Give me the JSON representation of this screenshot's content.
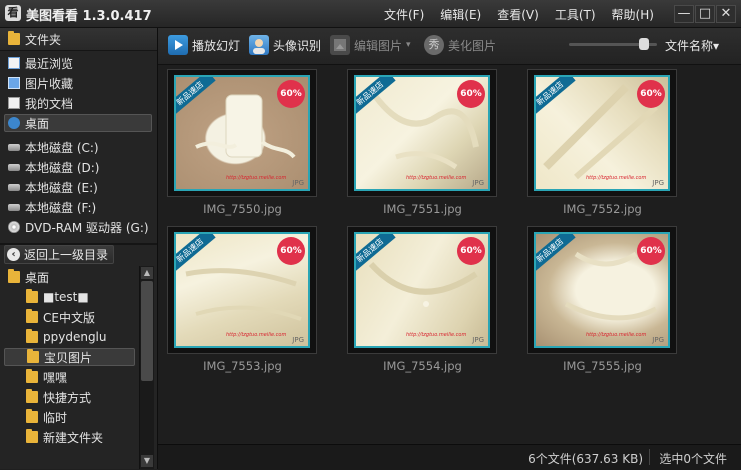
{
  "app": {
    "title": "美图看看 1.3.0.417",
    "icon_char": "看"
  },
  "menu": [
    {
      "label": "文件(F)"
    },
    {
      "label": "编辑(E)"
    },
    {
      "label": "查看(V)"
    },
    {
      "label": "工具(T)"
    },
    {
      "label": "帮助(H)"
    }
  ],
  "window_buttons": {
    "minimize": "—",
    "maximize": "□",
    "close": "✕"
  },
  "sidebar": {
    "header": "文件夹",
    "quick": [
      {
        "label": "最近浏览",
        "icon": "recent-icon"
      },
      {
        "label": "图片收藏",
        "icon": "favorites-icon"
      },
      {
        "label": "我的文档",
        "icon": "documents-icon"
      },
      {
        "label": "桌面",
        "icon": "desktop-icon",
        "selected": true
      }
    ],
    "drives": [
      {
        "label": "本地磁盘 (C:)"
      },
      {
        "label": "本地磁盘 (D:)"
      },
      {
        "label": "本地磁盘 (E:)"
      },
      {
        "label": "本地磁盘 (F:)"
      },
      {
        "label": "DVD-RAM 驱动器 (G:)"
      }
    ],
    "back_button": "返回上一级目录",
    "tree": [
      {
        "label": "桌面",
        "level": 0
      },
      {
        "label": "■test■",
        "level": 1
      },
      {
        "label": "CE中文版",
        "level": 1
      },
      {
        "label": "ppydenglu",
        "level": 1
      },
      {
        "label": "宝贝图片",
        "level": 1,
        "selected": true
      },
      {
        "label": "嘿嘿",
        "level": 1
      },
      {
        "label": "快捷方式",
        "level": 1
      },
      {
        "label": "临时",
        "level": 1
      },
      {
        "label": "新建文件夹",
        "level": 1
      }
    ]
  },
  "toolbar": {
    "slideshow": "播放幻灯",
    "face_detect": "头像识别",
    "edit": "编辑图片",
    "beautify": "美化图片",
    "beautify_icon_char": "秀",
    "sort": "文件名称▾",
    "zoom_level": 0.9
  },
  "thumb_overlay": {
    "badge": "新品速店",
    "sale_pct": "60%",
    "sale_top": "SALE",
    "watermark": "http://tzgtuo.meilie.com",
    "ext": "JPG"
  },
  "files": [
    {
      "name": "IMG_7550.jpg"
    },
    {
      "name": "IMG_7551.jpg"
    },
    {
      "name": "IMG_7552.jpg"
    },
    {
      "name": "IMG_7553.jpg"
    },
    {
      "name": "IMG_7554.jpg"
    },
    {
      "name": "IMG_7555.jpg"
    }
  ],
  "status": {
    "summary": "6个文件(637.63 KB)",
    "selection": "选中0个文件"
  },
  "colors": {
    "thumb_border": "#2aa5b5",
    "folder": "#e9b43a",
    "sale_badge": "#e0314b"
  }
}
